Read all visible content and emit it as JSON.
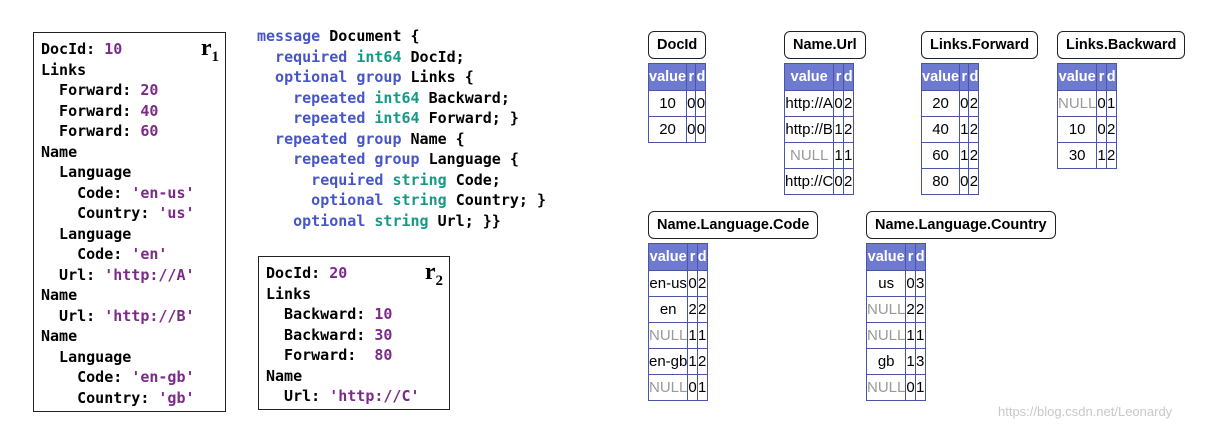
{
  "record1": {
    "label": "r",
    "label_sub": "1",
    "lines": [
      [
        {
          "t": "DocId: ",
          "c": "k"
        },
        {
          "t": "10",
          "c": "v"
        }
      ],
      [
        {
          "t": "Links",
          "c": "k"
        }
      ],
      [
        {
          "t": "  Forward: ",
          "c": "k"
        },
        {
          "t": "20",
          "c": "v"
        }
      ],
      [
        {
          "t": "  Forward: ",
          "c": "k"
        },
        {
          "t": "40",
          "c": "v"
        }
      ],
      [
        {
          "t": "  Forward: ",
          "c": "k"
        },
        {
          "t": "60",
          "c": "v"
        }
      ],
      [
        {
          "t": "Name",
          "c": "k"
        }
      ],
      [
        {
          "t": "  Language",
          "c": "k"
        }
      ],
      [
        {
          "t": "    Code: ",
          "c": "k"
        },
        {
          "t": "'en-us'",
          "c": "v"
        }
      ],
      [
        {
          "t": "    Country: ",
          "c": "k"
        },
        {
          "t": "'us'",
          "c": "v"
        }
      ],
      [
        {
          "t": "  Language",
          "c": "k"
        }
      ],
      [
        {
          "t": "    Code: ",
          "c": "k"
        },
        {
          "t": "'en'",
          "c": "v"
        }
      ],
      [
        {
          "t": "  Url: ",
          "c": "k"
        },
        {
          "t": "'http://A'",
          "c": "v"
        }
      ],
      [
        {
          "t": "Name",
          "c": "k"
        }
      ],
      [
        {
          "t": "  Url: ",
          "c": "k"
        },
        {
          "t": "'http://B'",
          "c": "v"
        }
      ],
      [
        {
          "t": "Name",
          "c": "k"
        }
      ],
      [
        {
          "t": "  Language",
          "c": "k"
        }
      ],
      [
        {
          "t": "    Code: ",
          "c": "k"
        },
        {
          "t": "'en-gb'",
          "c": "v"
        }
      ],
      [
        {
          "t": "    Country: ",
          "c": "k"
        },
        {
          "t": "'gb'",
          "c": "v"
        }
      ]
    ]
  },
  "record2": {
    "label": "r",
    "label_sub": "2",
    "lines": [
      [
        {
          "t": "DocId: ",
          "c": "k"
        },
        {
          "t": "20",
          "c": "v"
        }
      ],
      [
        {
          "t": "Links",
          "c": "k"
        }
      ],
      [
        {
          "t": "  Backward: ",
          "c": "k"
        },
        {
          "t": "10",
          "c": "v"
        }
      ],
      [
        {
          "t": "  Backward: ",
          "c": "k"
        },
        {
          "t": "30",
          "c": "v"
        }
      ],
      [
        {
          "t": "  Forward:  ",
          "c": "k"
        },
        {
          "t": "80",
          "c": "v"
        }
      ],
      [
        {
          "t": "Name",
          "c": "k"
        }
      ],
      [
        {
          "t": "  Url: ",
          "c": "k"
        },
        {
          "t": "'http://C'",
          "c": "v"
        }
      ]
    ]
  },
  "schema": {
    "lines": [
      [
        {
          "t": "message ",
          "c": "kw"
        },
        {
          "t": "Document {",
          "c": "nm"
        }
      ],
      [
        {
          "t": "  required ",
          "c": "kw"
        },
        {
          "t": "int64 ",
          "c": "ty"
        },
        {
          "t": "DocId;",
          "c": "nm"
        }
      ],
      [
        {
          "t": "  optional ",
          "c": "kw"
        },
        {
          "t": "group ",
          "c": "kw"
        },
        {
          "t": "Links {",
          "c": "nm"
        }
      ],
      [
        {
          "t": "    repeated ",
          "c": "kw"
        },
        {
          "t": "int64 ",
          "c": "ty"
        },
        {
          "t": "Backward;",
          "c": "nm"
        }
      ],
      [
        {
          "t": "    repeated ",
          "c": "kw"
        },
        {
          "t": "int64 ",
          "c": "ty"
        },
        {
          "t": "Forward; }",
          "c": "nm"
        }
      ],
      [
        {
          "t": "  repeated ",
          "c": "kw"
        },
        {
          "t": "group ",
          "c": "kw"
        },
        {
          "t": "Name {",
          "c": "nm"
        }
      ],
      [
        {
          "t": "    repeated ",
          "c": "kw"
        },
        {
          "t": "group ",
          "c": "kw"
        },
        {
          "t": "Language {",
          "c": "nm"
        }
      ],
      [
        {
          "t": "      required ",
          "c": "kw"
        },
        {
          "t": "string ",
          "c": "ty"
        },
        {
          "t": "Code;",
          "c": "nm"
        }
      ],
      [
        {
          "t": "      optional ",
          "c": "kw"
        },
        {
          "t": "string ",
          "c": "ty"
        },
        {
          "t": "Country; }",
          "c": "nm"
        }
      ],
      [
        {
          "t": "    optional ",
          "c": "kw"
        },
        {
          "t": "string ",
          "c": "ty"
        },
        {
          "t": "Url; }}",
          "c": "nm"
        }
      ]
    ]
  },
  "column_headers": [
    "value",
    "r",
    "d"
  ],
  "tables": [
    {
      "id": "docid",
      "title": "DocId",
      "rows": [
        [
          "10",
          "0",
          "0"
        ],
        [
          "20",
          "0",
          "0"
        ]
      ]
    },
    {
      "id": "name-url",
      "title": "Name.Url",
      "rows": [
        [
          "http://A",
          "0",
          "2"
        ],
        [
          "http://B",
          "1",
          "2"
        ],
        [
          "NULL",
          "1",
          "1"
        ],
        [
          "http://C",
          "0",
          "2"
        ]
      ]
    },
    {
      "id": "links-forward",
      "title": "Links.Forward",
      "rows": [
        [
          "20",
          "0",
          "2"
        ],
        [
          "40",
          "1",
          "2"
        ],
        [
          "60",
          "1",
          "2"
        ],
        [
          "80",
          "0",
          "2"
        ]
      ]
    },
    {
      "id": "links-backward",
      "title": "Links.Backward",
      "rows": [
        [
          "NULL",
          "0",
          "1"
        ],
        [
          "10",
          "0",
          "2"
        ],
        [
          "30",
          "1",
          "2"
        ]
      ]
    },
    {
      "id": "name-language-code",
      "title": "Name.Language.Code",
      "rows": [
        [
          "en-us",
          "0",
          "2"
        ],
        [
          "en",
          "2",
          "2"
        ],
        [
          "NULL",
          "1",
          "1"
        ],
        [
          "en-gb",
          "1",
          "2"
        ],
        [
          "NULL",
          "0",
          "1"
        ]
      ]
    },
    {
      "id": "name-language-country",
      "title": "Name.Language.Country",
      "rows": [
        [
          "us",
          "0",
          "3"
        ],
        [
          "NULL",
          "2",
          "2"
        ],
        [
          "NULL",
          "1",
          "1"
        ],
        [
          "gb",
          "1",
          "3"
        ],
        [
          "NULL",
          "0",
          "1"
        ]
      ]
    }
  ],
  "null_token": "NULL",
  "colors": {
    "keyword": "#4656c8",
    "type": "#159a86",
    "value": "#7b2a8a",
    "table_header": "#6e7ad0",
    "null_text": "#9a9a9a"
  },
  "watermark": "https://blog.csdn.net/Leonardy"
}
